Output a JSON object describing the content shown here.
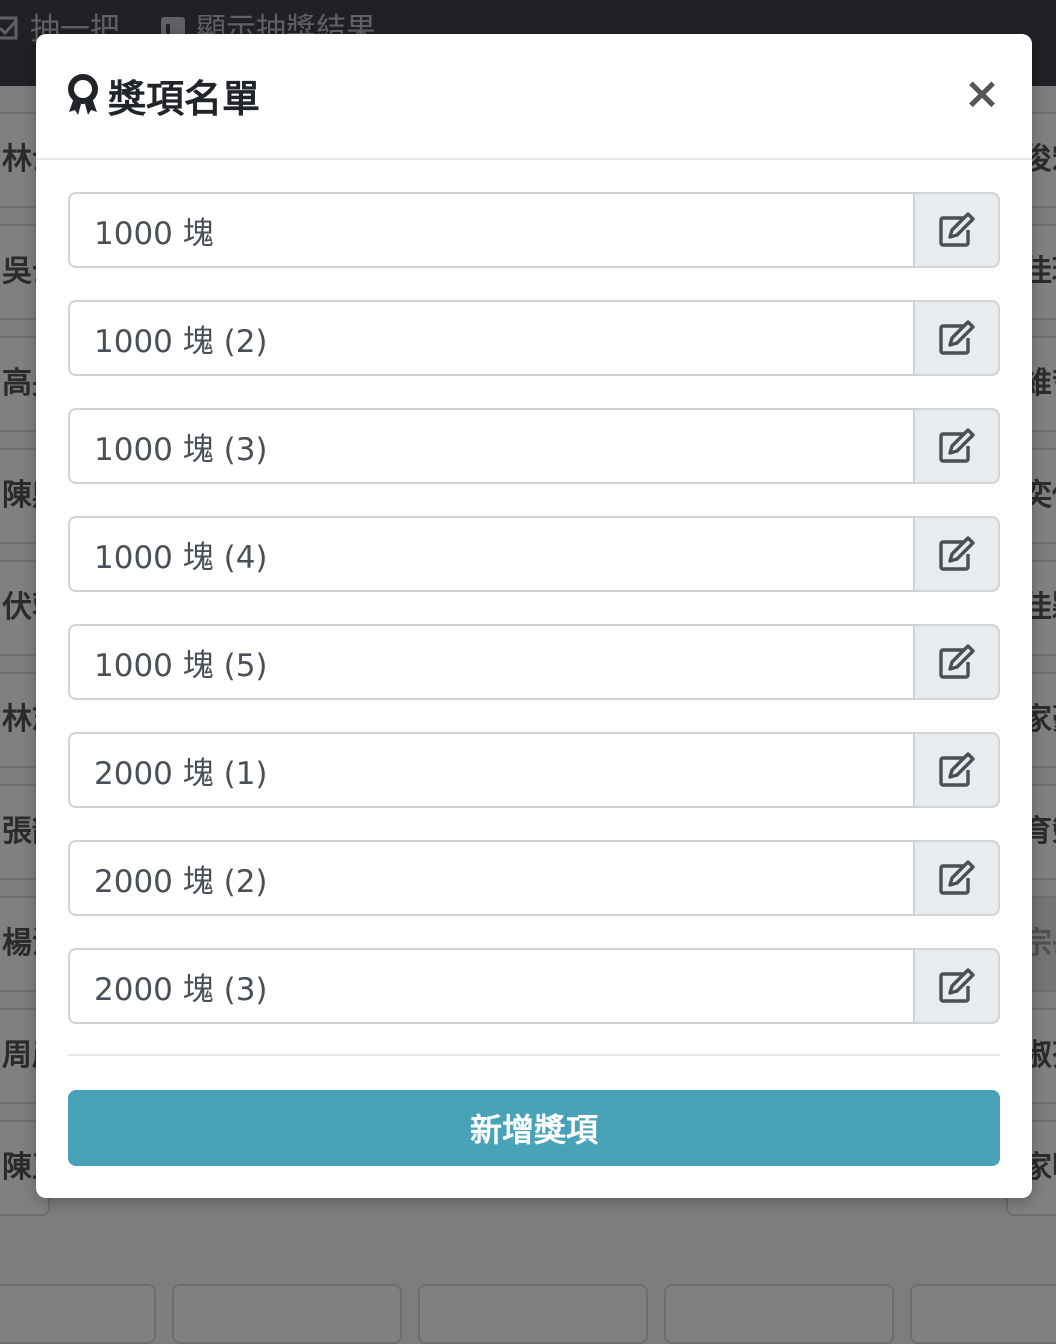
{
  "background": {
    "nav": [
      {
        "label": "抽一把"
      },
      {
        "label": "顯示抽獎結果"
      }
    ],
    "left_column": [
      "林士",
      "吳云",
      "高旻",
      "陳鼎",
      "伏蓉",
      "林志",
      "張韶",
      "楊浩",
      "周彥",
      "陳正"
    ],
    "right_column": [
      "俊宏",
      "佳玿",
      "維哲",
      "奕伶",
      "佳穎",
      "家豪",
      "育榮",
      "宗岳",
      "淑芬",
      "家明"
    ]
  },
  "modal": {
    "title": "獎項名單",
    "title_icon": "award-icon",
    "close_label": "×",
    "prizes": [
      {
        "value": "1000 塊"
      },
      {
        "value": "1000 塊 (2)"
      },
      {
        "value": "1000 塊 (3)"
      },
      {
        "value": "1000 塊 (4)"
      },
      {
        "value": "1000 塊 (5)"
      },
      {
        "value": "2000 塊 (1)"
      },
      {
        "value": "2000 塊 (2)"
      },
      {
        "value": "2000 塊 (3)"
      }
    ],
    "edit_icon": "edit-icon",
    "add_button_label": "新增獎項"
  },
  "colors": {
    "accent": "#49a3b8",
    "overlay": "#7d7d7d",
    "navbar": "#1f2125"
  }
}
